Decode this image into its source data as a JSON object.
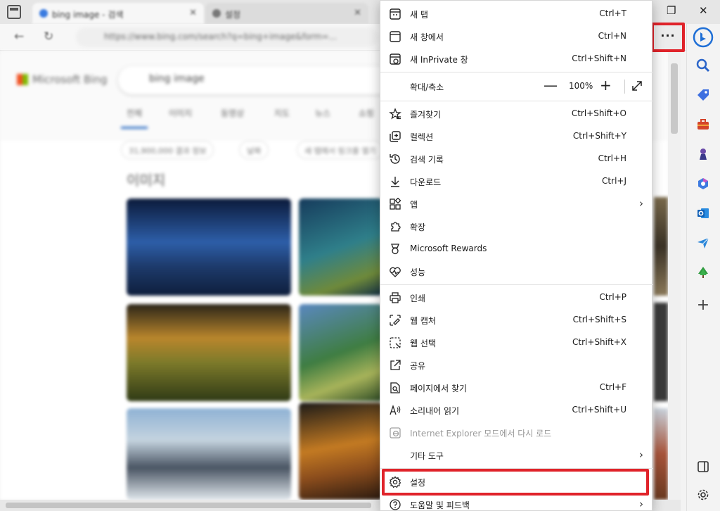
{
  "browser": {
    "tabs": [
      {
        "title": "bing image - 검색"
      },
      {
        "title": "설정"
      }
    ],
    "address": "https://www.bing.com/search?q=bing+image&form=..."
  },
  "page": {
    "logo": "Microsoft Bing",
    "search_query": "bing image",
    "tabs": [
      "전체",
      "이미지",
      "동영상",
      "지도",
      "뉴스",
      "쇼핑"
    ],
    "results_count": "31,900,000 결과 정보",
    "filter_date": "날짜",
    "filter_open": "새 탭에서 링크를 열기",
    "section_title": "이미지"
  },
  "menu": {
    "more_button": "···",
    "items": [
      {
        "label": "새 탭",
        "shortcut": "Ctrl+T",
        "icon": "new-tab-icon"
      },
      {
        "label": "새 창에서",
        "shortcut": "Ctrl+N",
        "icon": "new-window-icon"
      },
      {
        "label": "새 InPrivate 창",
        "shortcut": "Ctrl+Shift+N",
        "icon": "inprivate-icon"
      },
      {
        "label": "즐겨찾기",
        "shortcut": "Ctrl+Shift+O",
        "icon": "favorites-icon"
      },
      {
        "label": "컬렉션",
        "shortcut": "Ctrl+Shift+Y",
        "icon": "collections-icon"
      },
      {
        "label": "검색 기록",
        "shortcut": "Ctrl+H",
        "icon": "history-icon"
      },
      {
        "label": "다운로드",
        "shortcut": "Ctrl+J",
        "icon": "download-icon"
      },
      {
        "label": "앱",
        "shortcut": "",
        "icon": "apps-icon"
      },
      {
        "label": "확장",
        "shortcut": "",
        "icon": "extensions-icon"
      },
      {
        "label": "Microsoft Rewards",
        "shortcut": "",
        "icon": "rewards-icon"
      },
      {
        "label": "성능",
        "shortcut": "",
        "icon": "performance-icon"
      },
      {
        "label": "인쇄",
        "shortcut": "Ctrl+P",
        "icon": "print-icon"
      },
      {
        "label": "웹 캡처",
        "shortcut": "Ctrl+Shift+S",
        "icon": "web-capture-icon"
      },
      {
        "label": "웹 선택",
        "shortcut": "Ctrl+Shift+X",
        "icon": "web-select-icon"
      },
      {
        "label": "공유",
        "shortcut": "",
        "icon": "share-icon"
      },
      {
        "label": "페이지에서 찾기",
        "shortcut": "Ctrl+F",
        "icon": "find-icon"
      },
      {
        "label": "소리내어 읽기",
        "shortcut": "Ctrl+Shift+U",
        "icon": "read-aloud-icon"
      },
      {
        "label": "Internet Explorer 모드에서 다시 로드",
        "shortcut": "",
        "icon": "ie-mode-icon"
      },
      {
        "label": "기타 도구",
        "shortcut": "",
        "icon": ""
      },
      {
        "label": "설정",
        "shortcut": "",
        "icon": "gear-icon"
      },
      {
        "label": "도움말 및 피드백",
        "shortcut": "",
        "icon": "help-icon"
      }
    ],
    "zoom": {
      "label": "확대/축소",
      "value": "100%",
      "minus": "—",
      "plus": "+"
    }
  },
  "colors": {
    "highlight": "#e0232a",
    "bing_blue": "#1f6fd6"
  }
}
